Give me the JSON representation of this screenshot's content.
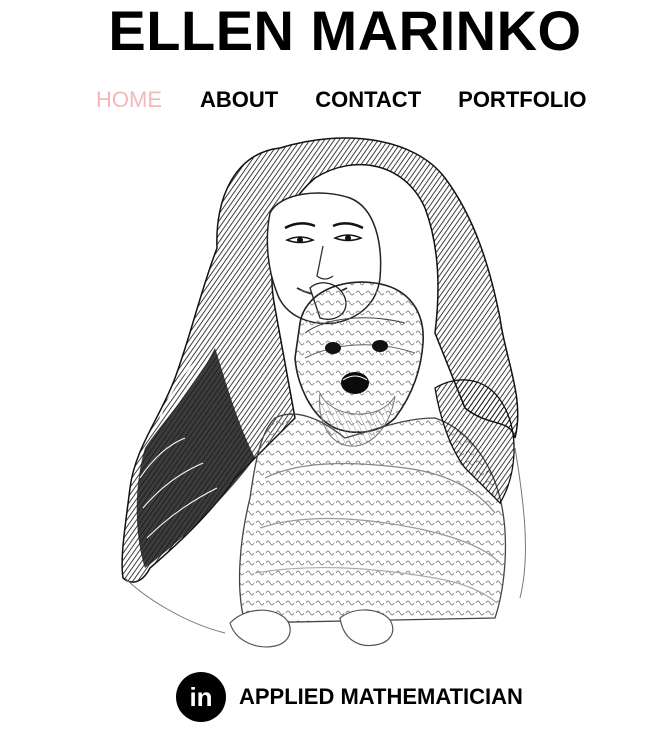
{
  "header": {
    "title": "ELLEN MARINKO"
  },
  "nav": {
    "items": [
      {
        "label": "HOME",
        "active": true
      },
      {
        "label": "ABOUT",
        "active": false
      },
      {
        "label": "CONTACT",
        "active": false
      },
      {
        "label": "PORTFOLIO",
        "active": false
      }
    ],
    "active_color": "#f4b8b8"
  },
  "hero": {
    "image_alt": "Sketch portrait of a woman holding a dog",
    "icon": "portrait-sketch"
  },
  "footer": {
    "social_icon": "linkedin-icon",
    "linkedin_label": "in",
    "tagline": "APPLIED MATHEMATICIAN"
  }
}
